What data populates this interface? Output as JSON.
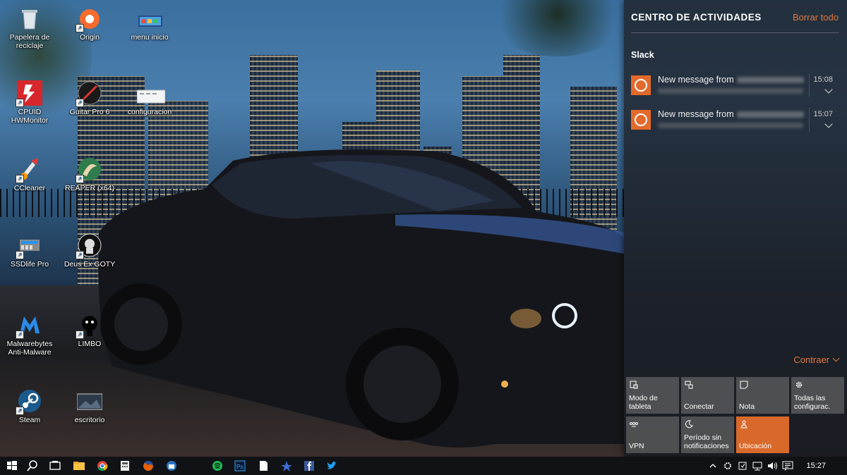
{
  "desktop": {
    "icons": [
      {
        "label": "Papelera de reciclaje",
        "icon": "recycle-bin-icon"
      },
      {
        "label": "Origin",
        "icon": "origin-icon"
      },
      {
        "label": "menu inicio",
        "icon": "folder-icon"
      },
      {
        "label": "CPUID HWMonitor",
        "icon": "hwmonitor-icon"
      },
      {
        "label": "Guitar Pro 6",
        "icon": "guitar-pro-icon"
      },
      {
        "label": "configuracion",
        "icon": "folder-icon"
      },
      {
        "label": "CCleaner",
        "icon": "ccleaner-icon"
      },
      {
        "label": "REAPER (x64)",
        "icon": "reaper-icon"
      },
      {
        "label": "SSDlife Pro",
        "icon": "ssdlife-icon"
      },
      {
        "label": "Deus Ex GOTY",
        "icon": "deus-ex-icon"
      },
      {
        "label": "Malwarebytes Anti-Malware",
        "icon": "malwarebytes-icon"
      },
      {
        "label": "LIMBO",
        "icon": "limbo-icon"
      },
      {
        "label": "Steam",
        "icon": "steam-icon"
      },
      {
        "label": "escritorio",
        "icon": "image-file-icon"
      }
    ]
  },
  "action_center": {
    "title": "CENTRO DE ACTIVIDADES",
    "clear_all": "Borrar todo",
    "app_name": "Slack",
    "notifications": [
      {
        "title": "New message from",
        "time": "15:08"
      },
      {
        "title": "New message from",
        "time": "15:07"
      }
    ],
    "collapse": "Contraer",
    "quick_actions": [
      {
        "label": "Modo de tableta",
        "icon": "tablet-mode-icon",
        "active": false
      },
      {
        "label": "Conectar",
        "icon": "connect-icon",
        "active": false
      },
      {
        "label": "Nota",
        "icon": "note-icon",
        "active": false
      },
      {
        "label": "Todas las configurac.",
        "icon": "settings-icon",
        "active": false
      },
      {
        "label": "VPN",
        "icon": "vpn-icon",
        "active": false
      },
      {
        "label": "Período sin notificaciones",
        "icon": "moon-icon",
        "active": false
      },
      {
        "label": "Ubicación",
        "icon": "location-icon",
        "active": true
      }
    ],
    "accent_color": "#d9692a"
  },
  "taskbar": {
    "clock": "15:27",
    "pinned": [
      "start-icon",
      "search-icon",
      "task-view-icon",
      "file-explorer-icon",
      "chrome-icon",
      "calculator-icon",
      "firefox-icon",
      "thunderbird-icon",
      "spotify-icon",
      "photoshop-icon",
      "document-icon",
      "app-icon",
      "facebook-icon",
      "twitter-icon"
    ],
    "tray": [
      "chevron-up-icon",
      "settings-tray-icon",
      "update-icon",
      "network-icon",
      "volume-icon",
      "action-center-icon"
    ]
  }
}
